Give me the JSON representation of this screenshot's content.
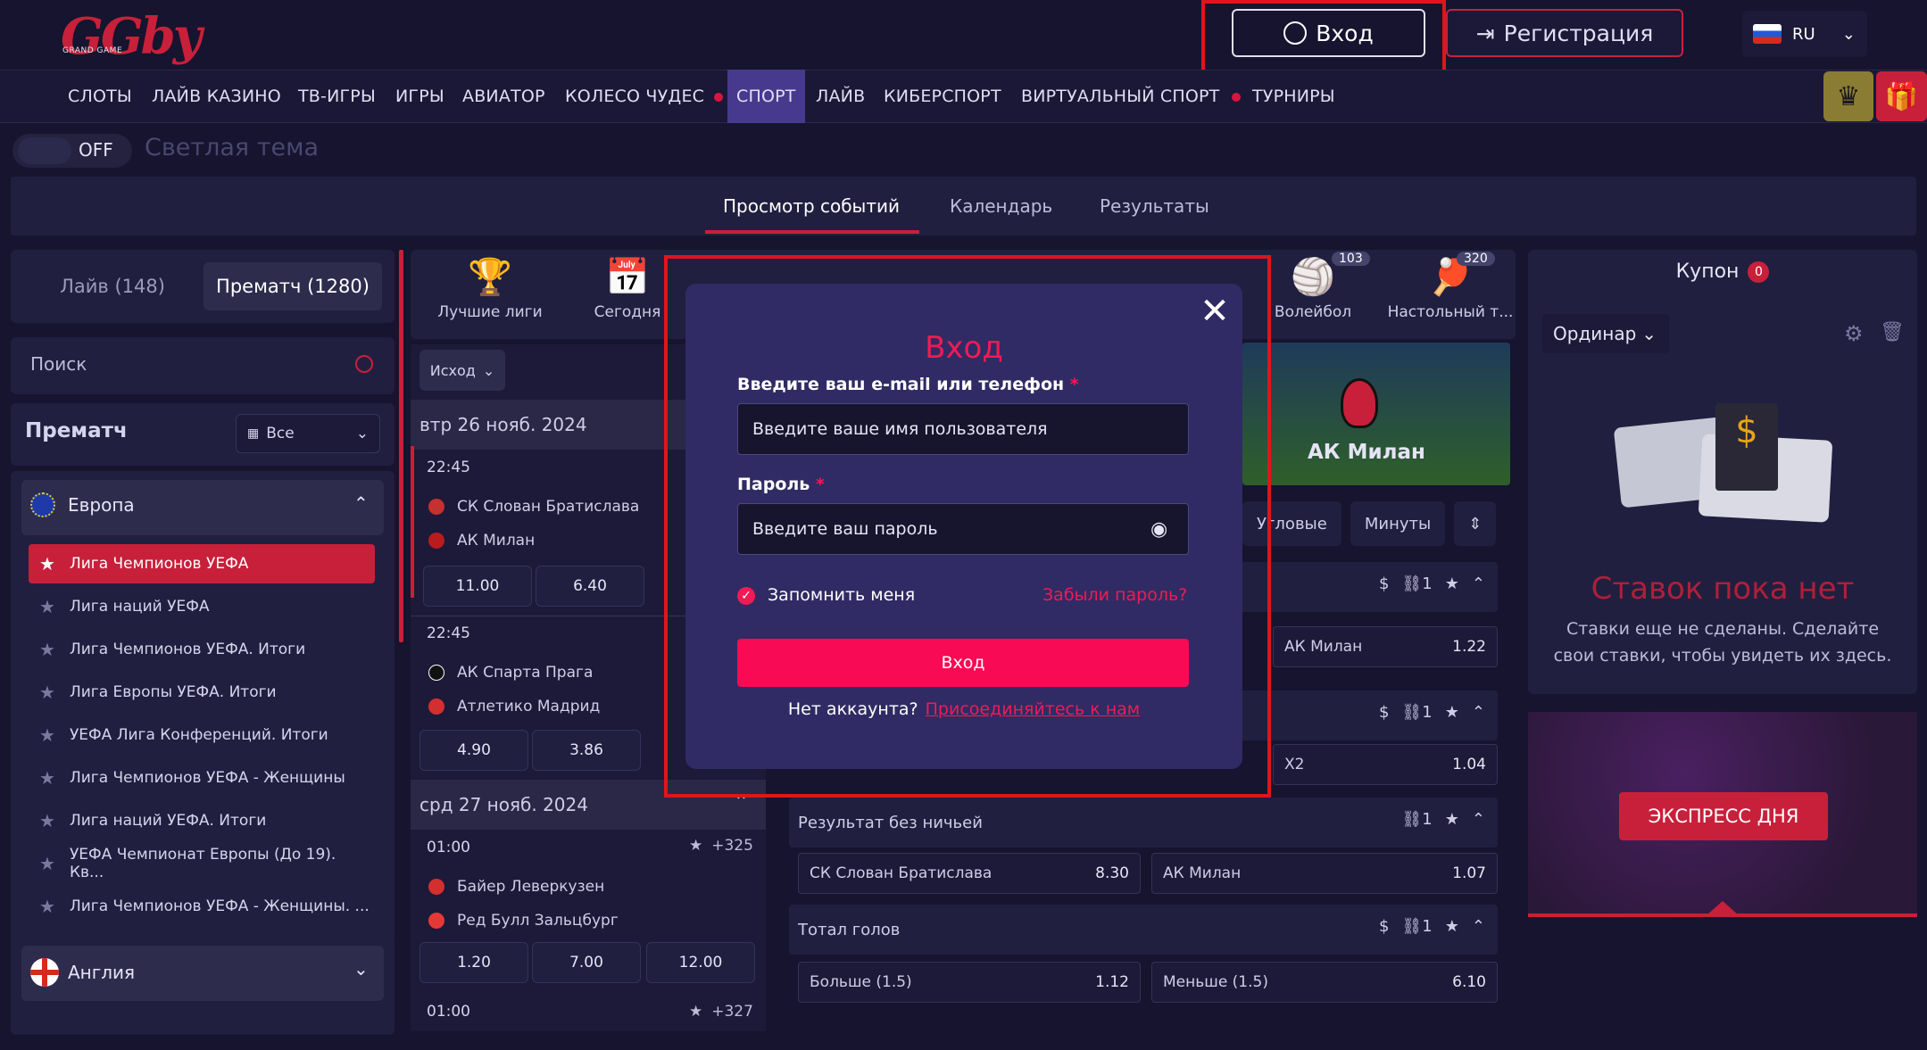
{
  "header": {
    "logo_text": "GGby",
    "logo_sub": "GRAND GAME",
    "login_label": "Вход",
    "register_label": "Регистрация",
    "lang": "RU"
  },
  "nav": {
    "items": [
      "СЛОТЫ",
      "ЛАЙВ КАЗИНО",
      "ТВ-ИГРЫ",
      "ИГРЫ",
      "АВИАТОР",
      "КОЛЕСО ЧУДЕС",
      "СПОРТ",
      "ЛАЙВ",
      "КИБЕРСПОРТ",
      "ВИРТУАЛЬНЫЙ СПОРТ",
      "ТУРНИРЫ"
    ],
    "active": "СПОРТ"
  },
  "theme": {
    "toggle_label": "OFF",
    "label": "Светлая тема"
  },
  "main_tabs": [
    "Просмотр событий",
    "Календарь",
    "Результаты"
  ],
  "sidebar": {
    "live_label": "Лайв (148)",
    "prematch_label": "Прематч (1280)",
    "search_placeholder": "Поиск",
    "prematch_title": "Прематч",
    "prematch_filter": "Все",
    "region": "Европа",
    "leagues": [
      "Лига Чемпионов УЕФА",
      "Лига наций УЕФА",
      "Лига Чемпионов УЕФА. Итоги",
      "Лига Европы УЕФА. Итоги",
      "УЕФА Лига Конференций. Итоги",
      "Лига Чемпионов УЕФА - Женщины",
      "Лига наций УЕФА. Итоги",
      "УЕФА Чемпионат Европы (До 19). Кв...",
      "Лига Чемпионов УЕФА - Женщины. ..."
    ],
    "region2": "Англия"
  },
  "sports": [
    {
      "label": "Лучшие лиги",
      "icon": "trophy-icon",
      "count": ""
    },
    {
      "label": "Сегодня",
      "icon": "calendar-icon",
      "count": ""
    },
    {
      "label": "Волейбол",
      "icon": "volleyball-icon",
      "count": "103"
    },
    {
      "label": "Настольный т...",
      "icon": "table-tennis-icon",
      "count": "320"
    }
  ],
  "events": {
    "filter": "Исход",
    "days": [
      {
        "date": "втр 26 нояб. 2024",
        "matches": [
          {
            "time": "22:45",
            "home": "СК Слован Братислава",
            "away": "АК Милан",
            "odds": [
              "11.00",
              "6.40"
            ]
          },
          {
            "time": "22:45",
            "home": "АК Спарта Прага",
            "away": "Атлетико Мадрид",
            "odds": [
              "4.90",
              "3.86"
            ]
          }
        ]
      },
      {
        "date": "срд 27 нояб. 2024",
        "matches": [
          {
            "time": "01:00",
            "home": "Байер Леверкузен",
            "away": "Ред Булл Зальцбург",
            "odds": [
              "1.20",
              "7.00",
              "12.00"
            ],
            "more": "+325"
          },
          {
            "time": "01:00",
            "more": "+327"
          }
        ]
      }
    ]
  },
  "event_detail": {
    "banner_team": "АК Милан",
    "tabs": [
      "Угловые",
      "Минуты"
    ],
    "row1": {
      "label": "АК Милан",
      "odd": "1.22"
    },
    "row2": {
      "label": "X2",
      "odd": "1.04"
    },
    "no_draw": {
      "title": "Результат без ничьей",
      "home": "СК Слован Братислава",
      "home_odd": "8.30",
      "away": "АК Милан",
      "away_odd": "1.07"
    },
    "total": {
      "title": "Тотал голов",
      "over": "Больше (1.5)",
      "over_odd": "1.12",
      "under": "Меньше (1.5)",
      "under_odd": "6.10"
    }
  },
  "coupon": {
    "title": "Купон",
    "count": "0",
    "mode": "Ординар",
    "empty_title": "Ставок пока нет",
    "empty_text": "Ставки еще не сделаны. Сделайте свои ставки, чтобы увидеть их здесь.",
    "express": "ЭКСПРЕСС ДНЯ"
  },
  "login_modal": {
    "title": "Вход",
    "login_label": "Введите ваш e-mail или телефон",
    "login_placeholder": "Введите ваше имя пользователя",
    "password_label": "Пароль",
    "password_placeholder": "Введите ваш пароль",
    "remember": "Запомнить меня",
    "forgot": "Забыли пароль?",
    "submit": "Вход",
    "no_account": "Нет аккаунта?",
    "join": "Присоединяйтесь к нам"
  }
}
